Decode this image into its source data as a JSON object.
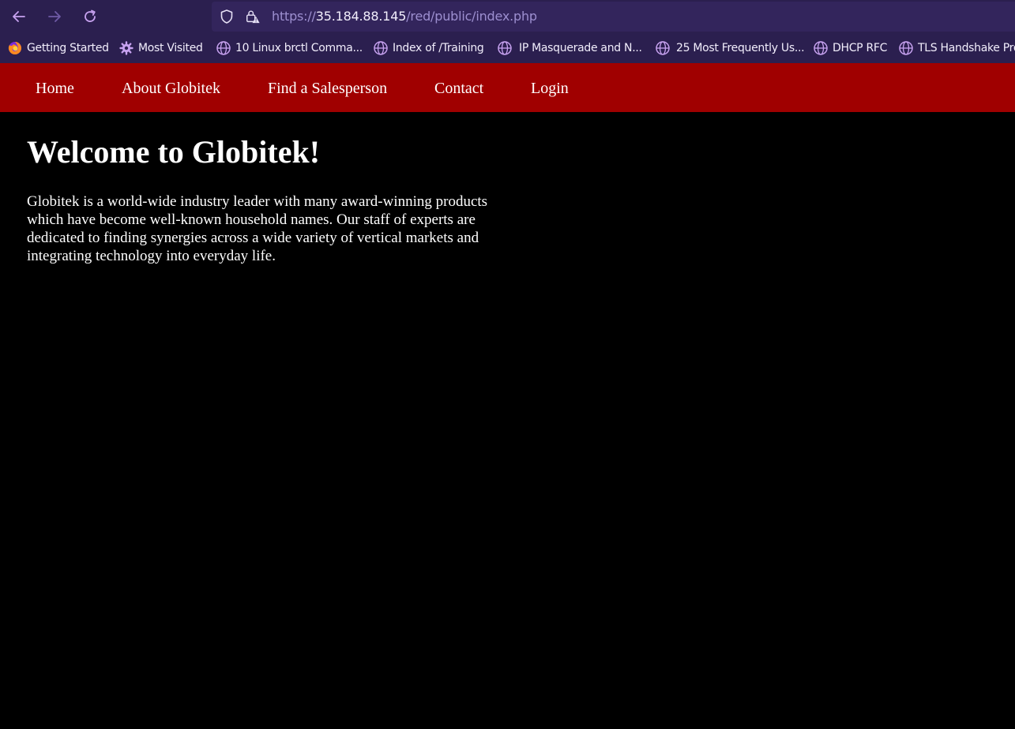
{
  "browser": {
    "back_icon": "arrow-left-icon",
    "forward_icon": "arrow-right-icon",
    "reload_icon": "reload-icon",
    "url": {
      "scheme": "https://",
      "host": "35.184.88.145",
      "path": "/red/public/index.php"
    },
    "colors": {
      "toolbar_bg": "#2b1f4f",
      "urlbar_bg": "#33255c",
      "icon": "#c7a2f0"
    }
  },
  "bookmarks": [
    {
      "label": "Getting Started",
      "icon": "firefox-icon"
    },
    {
      "label": "Most Visited",
      "icon": "gear-icon"
    },
    {
      "label": "10 Linux brctl Comma...",
      "icon": "globe-icon"
    },
    {
      "label": "Index of /Training",
      "icon": "globe-icon"
    },
    {
      "label": "IP Masquerade and N...",
      "icon": "globe-icon"
    },
    {
      "label": "25 Most Frequently Us...",
      "icon": "globe-icon"
    },
    {
      "label": "DHCP RFC",
      "icon": "globe-icon"
    },
    {
      "label": "TLS Handshake Pro",
      "icon": "globe-icon"
    }
  ],
  "site_nav": {
    "bg_color": "#a00000",
    "items": [
      {
        "label": "Home"
      },
      {
        "label": "About Globitek"
      },
      {
        "label": "Find a Salesperson"
      },
      {
        "label": "Contact"
      },
      {
        "label": "Login"
      }
    ]
  },
  "main": {
    "heading": "Welcome to Globitek!",
    "paragraph": "Globitek is a world-wide industry leader with many award-winning products which have become well-known household names. Our staff of experts are dedicated to finding synergies across a wide variety of vertical markets and integrating technology into everyday life."
  }
}
